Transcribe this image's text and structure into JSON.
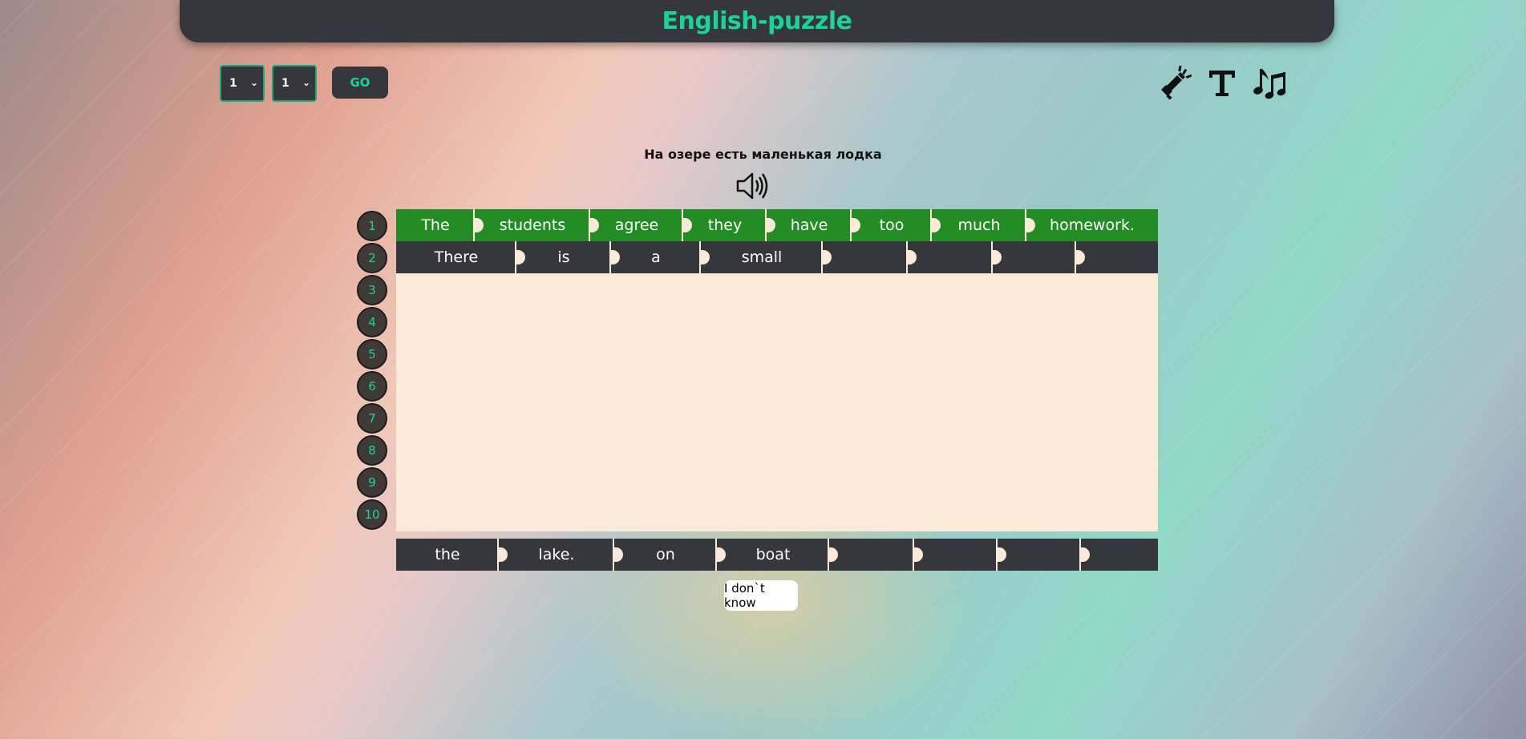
{
  "header": {
    "title": "English-puzzle"
  },
  "controls": {
    "level_select": {
      "value": "1"
    },
    "page_select": {
      "value": "1"
    },
    "go_label": "GO"
  },
  "hints": {
    "translation": "На озере есть маленькая лодка",
    "icons": [
      "translation-hint-icon",
      "text-hint-icon",
      "music-hint-icon",
      "pronounce-icon"
    ]
  },
  "rows": [
    "1",
    "2",
    "3",
    "4",
    "5",
    "6",
    "7",
    "8",
    "9",
    "10"
  ],
  "completed_row": [
    "The",
    "students",
    "agree",
    "they",
    "have",
    "too",
    "much",
    "homework."
  ],
  "current_row": [
    "There",
    "is",
    "a",
    "small",
    "",
    "",
    "",
    ""
  ],
  "word_bank": [
    "the",
    "lake.",
    "on",
    "boat",
    "",
    "",
    "",
    ""
  ],
  "dont_know_label": "I don`t know",
  "colors": {
    "accent": "#1dd19a",
    "panel": "#36373c",
    "correct": "#238c24",
    "board": "#faead7"
  }
}
